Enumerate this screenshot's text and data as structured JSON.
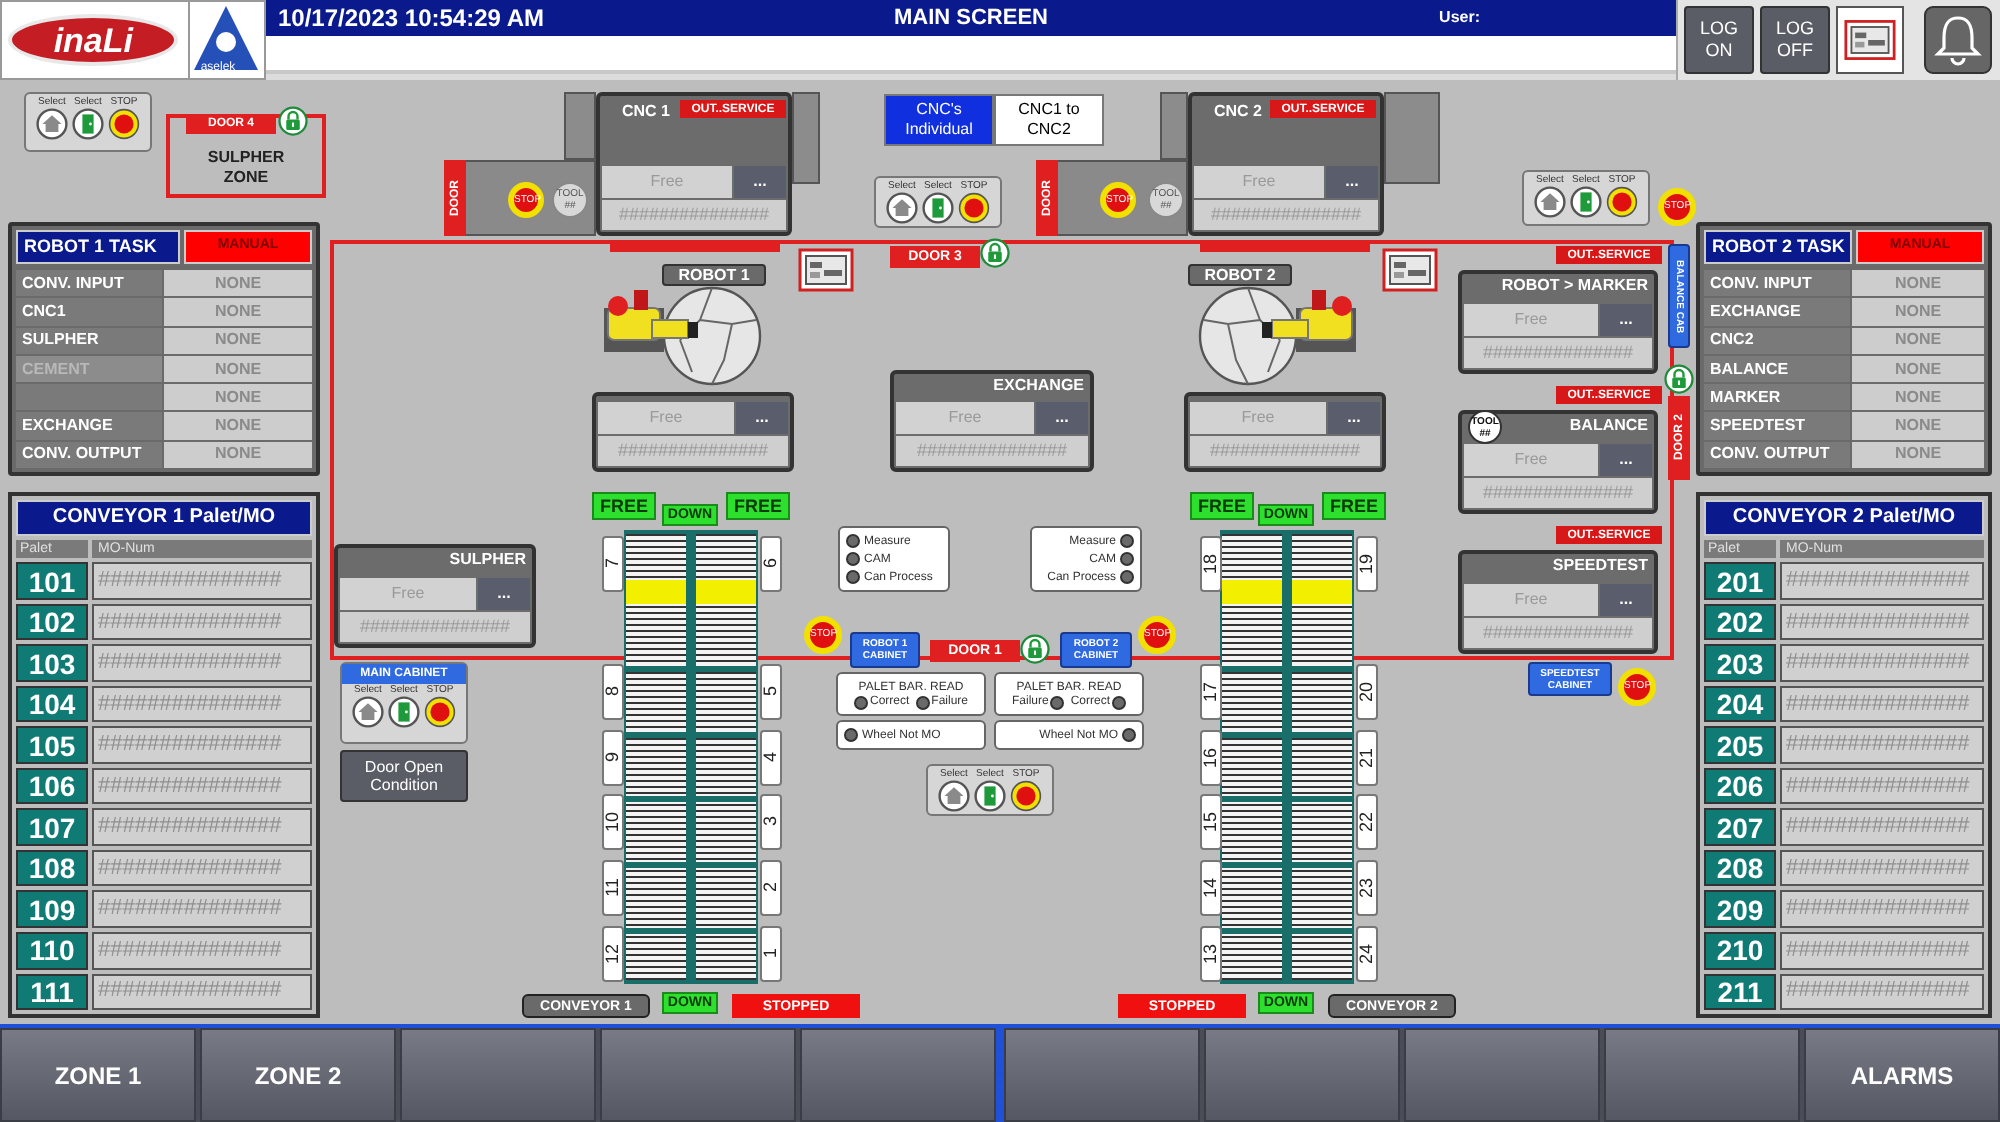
{
  "header": {
    "logo": "inaLi",
    "partner_logo": "aselek",
    "datetime": "10/17/2023 10:54:29 AM",
    "title": "MAIN SCREEN",
    "user_label": "User:",
    "buttons": [
      "LOG ON",
      "LOG OFF"
    ]
  },
  "robot_tasks": [
    {
      "title": "ROBOT 1 TASK",
      "mode": "MANUAL",
      "rows": [
        {
          "task": "CONV. INPUT",
          "value": "NONE",
          "disabled": false
        },
        {
          "task": "CNC1",
          "value": "NONE",
          "disabled": false
        },
        {
          "task": "SULPHER",
          "value": "NONE",
          "disabled": false
        },
        {
          "task": "CEMENT",
          "value": "NONE",
          "disabled": true
        },
        {
          "value": "NONE",
          "disabled": false
        },
        {
          "task": "EXCHANGE",
          "value": "NONE",
          "disabled": false
        },
        {
          "task": "CONV. OUTPUT",
          "value": "NONE",
          "disabled": false
        }
      ]
    },
    {
      "title": "ROBOT 2 TASK",
      "mode": "MANUAL",
      "rows": [
        {
          "task": "CONV. INPUT",
          "value": "NONE",
          "disabled": false
        },
        {
          "task": "EXCHANGE",
          "value": "NONE",
          "disabled": false
        },
        {
          "task": "CNC2",
          "value": "NONE",
          "disabled": false
        },
        {
          "task": "BALANCE",
          "value": "NONE",
          "disabled": false
        },
        {
          "task": "MARKER",
          "value": "NONE",
          "disabled": false
        },
        {
          "task": "SPEEDTEST",
          "value": "NONE",
          "disabled": false
        },
        {
          "task": "CONV. OUTPUT",
          "value": "NONE",
          "disabled": false
        }
      ]
    }
  ],
  "conveyor_tables": [
    {
      "title": "CONVEYOR 1 Palet/MO",
      "columns": [
        "Palet",
        "MO-Num"
      ],
      "rows": [
        {
          "palet": "101",
          "mo_num": "###############"
        },
        {
          "palet": "102",
          "mo_num": "###############"
        },
        {
          "palet": "103",
          "mo_num": "###############"
        },
        {
          "palet": "104",
          "mo_num": "###############"
        },
        {
          "palet": "105",
          "mo_num": "###############"
        },
        {
          "palet": "106",
          "mo_num": "###############"
        },
        {
          "palet": "107",
          "mo_num": "###############"
        },
        {
          "palet": "108",
          "mo_num": "###############"
        },
        {
          "palet": "109",
          "mo_num": "###############"
        },
        {
          "palet": "110",
          "mo_num": "###############"
        },
        {
          "palet": "111",
          "mo_num": "###############"
        }
      ]
    },
    {
      "title": "CONVEYOR 2 Palet/MO",
      "columns": [
        "Palet",
        "MO-Num"
      ],
      "rows": [
        {
          "palet": "201",
          "mo_num": "###############"
        },
        {
          "palet": "202",
          "mo_num": "###############"
        },
        {
          "palet": "203",
          "mo_num": "###############"
        },
        {
          "palet": "204",
          "mo_num": "###############"
        },
        {
          "palet": "205",
          "mo_num": "###############"
        },
        {
          "palet": "206",
          "mo_num": "###############"
        },
        {
          "palet": "207",
          "mo_num": "###############"
        },
        {
          "palet": "208",
          "mo_num": "###############"
        },
        {
          "palet": "209",
          "mo_num": "###############"
        },
        {
          "palet": "210",
          "mo_num": "###############"
        },
        {
          "palet": "211",
          "mo_num": "###############"
        }
      ]
    }
  ],
  "control_stations": [
    {
      "labels": [
        "Select",
        "Select",
        "STOP"
      ]
    },
    {
      "labels": [
        "Select",
        "Select",
        "STOP"
      ]
    },
    {
      "labels": [
        "Select",
        "Select",
        "STOP"
      ]
    },
    {
      "labels": [
        "Select",
        "Select",
        "STOP"
      ]
    }
  ],
  "main_cabinet": {
    "title": "MAIN CABINET",
    "labels": [
      "Select",
      "Select",
      "STOP"
    ],
    "button": "Door Open Condition"
  },
  "sulpher_zone": {
    "door": "DOOR 4",
    "label": "SULPHER ZONE"
  },
  "cnc_mode": [
    {
      "label": "CNC's Individual",
      "selected": true
    },
    {
      "label": "CNC1 to CNC2",
      "selected": false
    }
  ],
  "cncs": [
    {
      "name": "CNC 1",
      "status": "OUT..SERVICE",
      "door": "DOOR",
      "stop": "STOP",
      "tool": "TOOL ##",
      "value": "Free",
      "menu": "...",
      "mo": "###############"
    },
    {
      "name": "CNC 2",
      "status": "OUT..SERVICE",
      "door": "DOOR",
      "stop": "STOP",
      "tool": "TOOL ##",
      "value": "Free",
      "menu": "...",
      "mo": "###############"
    }
  ],
  "doors": [
    "DOOR 3",
    "DOOR 1",
    "DOOR 2"
  ],
  "robots": [
    "ROBOT 1",
    "ROBOT 2"
  ],
  "stations": [
    {
      "value": "Free",
      "menu": "...",
      "mo": "###############"
    },
    {
      "title": "EXCHANGE",
      "value": "Free",
      "menu": "...",
      "mo": "###############"
    },
    {
      "value": "Free",
      "menu": "...",
      "mo": "###############"
    },
    {
      "title": "SULPHER",
      "value": "Free",
      "menu": "...",
      "mo": "###############"
    },
    {
      "title": "ROBOT > MARKER",
      "status": "OUT..SERVICE",
      "value": "Free",
      "menu": "...",
      "mo": "###############"
    },
    {
      "title": "BALANCE",
      "status": "OUT..SERVICE",
      "tool": "TOOL ##",
      "value": "Free",
      "menu": "...",
      "mo": "###############"
    },
    {
      "title": "SPEEDTEST",
      "status": "OUT..SERVICE",
      "value": "Free",
      "menu": "...",
      "mo": "###############"
    }
  ],
  "cabinets": [
    "ROBOT 1 CABINET",
    "ROBOT 2 CABINET",
    "SPEEDTEST CABINET",
    "BALANCE CAB"
  ],
  "stop_buttons": [
    "STOP",
    "STOP",
    "STOP",
    "STOP"
  ],
  "sensor_panels": [
    {
      "items": [
        "Measure",
        "CAM",
        "Can Process"
      ]
    },
    {
      "items": [
        "Measure",
        "CAM",
        "Can Process"
      ]
    }
  ],
  "barcode_readers": [
    {
      "title": "PALET BAR. READ",
      "items": [
        "Correct",
        "Failure"
      ],
      "wheel": "Wheel Not MO"
    },
    {
      "title": "PALET BAR. READ",
      "items": [
        "Failure",
        "Correct"
      ],
      "wheel": "Wheel Not MO"
    }
  ],
  "conveyor_lines": [
    {
      "top": [
        "FREE",
        "DOWN",
        "FREE"
      ],
      "left_slots": [
        "7",
        "8",
        "9",
        "10",
        "11",
        "12"
      ],
      "right_slots": [
        "6",
        "5",
        "4",
        "3",
        "2",
        "1"
      ],
      "name": "CONVEYOR 1",
      "direction": "DOWN",
      "state": "STOPPED"
    },
    {
      "top": [
        "FREE",
        "DOWN",
        "FREE"
      ],
      "left_slots": [
        "18",
        "17",
        "16",
        "15",
        "14",
        "13"
      ],
      "right_slots": [
        "19",
        "20",
        "21",
        "22",
        "23",
        "24"
      ],
      "name": "CONVEYOR 2",
      "direction": "DOWN",
      "state": "STOPPED"
    }
  ],
  "footer": {
    "left": [
      "ZONE 1",
      "ZONE 2"
    ],
    "right": [
      "ALARMS"
    ]
  }
}
